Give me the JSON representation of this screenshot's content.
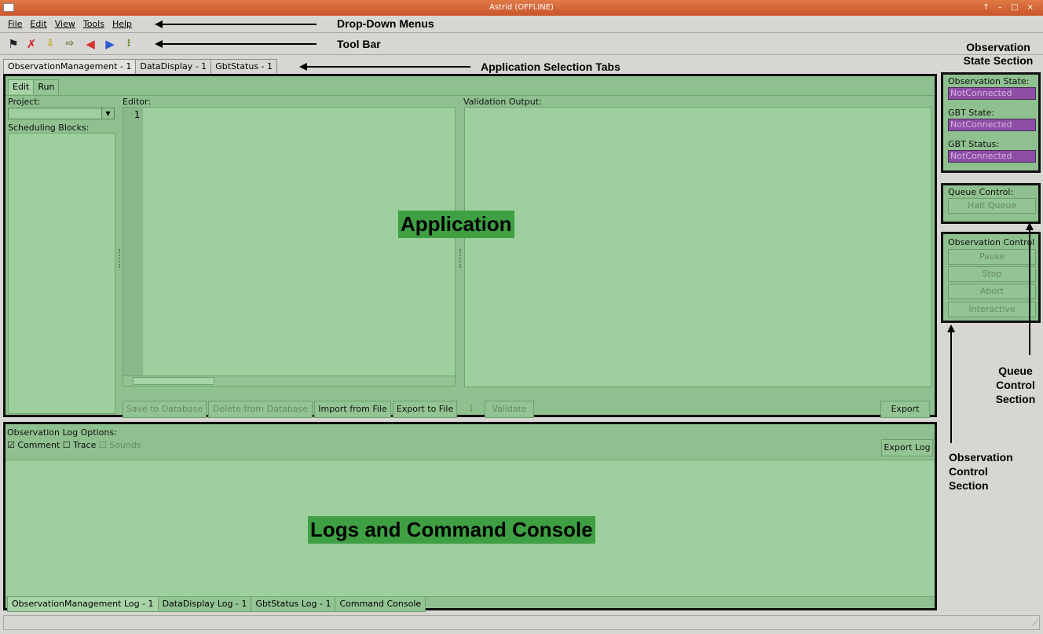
{
  "window": {
    "title": "Astrid (OFFLINE)",
    "controls": "↑ – □ ×"
  },
  "menu": {
    "items": [
      "File",
      "Edit",
      "View",
      "Tools",
      "Help"
    ]
  },
  "annotations": {
    "dropdown_menus": "Drop-Down Menus",
    "tool_bar": "Tool Bar",
    "app_tabs": "Application Selection Tabs",
    "obs_state_section": "Observation State Section",
    "queue_control_section": "Queue Control Section",
    "obs_control_section": "Observation Control Section",
    "application": "Application",
    "logs_console": "Logs and Command Console"
  },
  "app_tabs": [
    "ObservationManagement - 1",
    "DataDisplay - 1",
    "GbtStatus - 1"
  ],
  "subtabs": [
    "Edit",
    "Run"
  ],
  "editor": {
    "project_label": "Project:",
    "scheduling_blocks_label": "Scheduling Blocks:",
    "editor_label": "Editor:",
    "line_number": "1",
    "validation_label": "Validation Output:",
    "buttons": {
      "save": "Save to Database",
      "delete": "Delete from Database",
      "import": "Import from File",
      "export_file": "Export to File",
      "validate": "Validate",
      "export": "Export"
    }
  },
  "logs": {
    "options_label": "Observation Log Options:",
    "comment": "Comment",
    "trace": "Trace",
    "sounds": "Sounds",
    "export_log": "Export Log",
    "tabs": [
      "ObservationManagement Log - 1",
      "DataDisplay Log - 1",
      "GbtStatus Log - 1",
      "Command Console"
    ]
  },
  "state": {
    "obs_state_label": "Observation State:",
    "obs_state_value": "NotConnected",
    "gbt_state_label": "GBT State:",
    "gbt_state_value": "NotConnected",
    "gbt_status_label": "GBT Status:",
    "gbt_status_value": "NotConnected"
  },
  "queue": {
    "label": "Queue Control:",
    "halt": "Halt Queue"
  },
  "obs_control": {
    "label": "Observation Control",
    "pause": "Pause",
    "stop": "Stop",
    "abort": "Abort",
    "interactive": "Interactive"
  },
  "colors": {
    "panel_green": "#8fc08f",
    "state_purple": "#8d4fa6",
    "titlebar": "#d4612f"
  }
}
